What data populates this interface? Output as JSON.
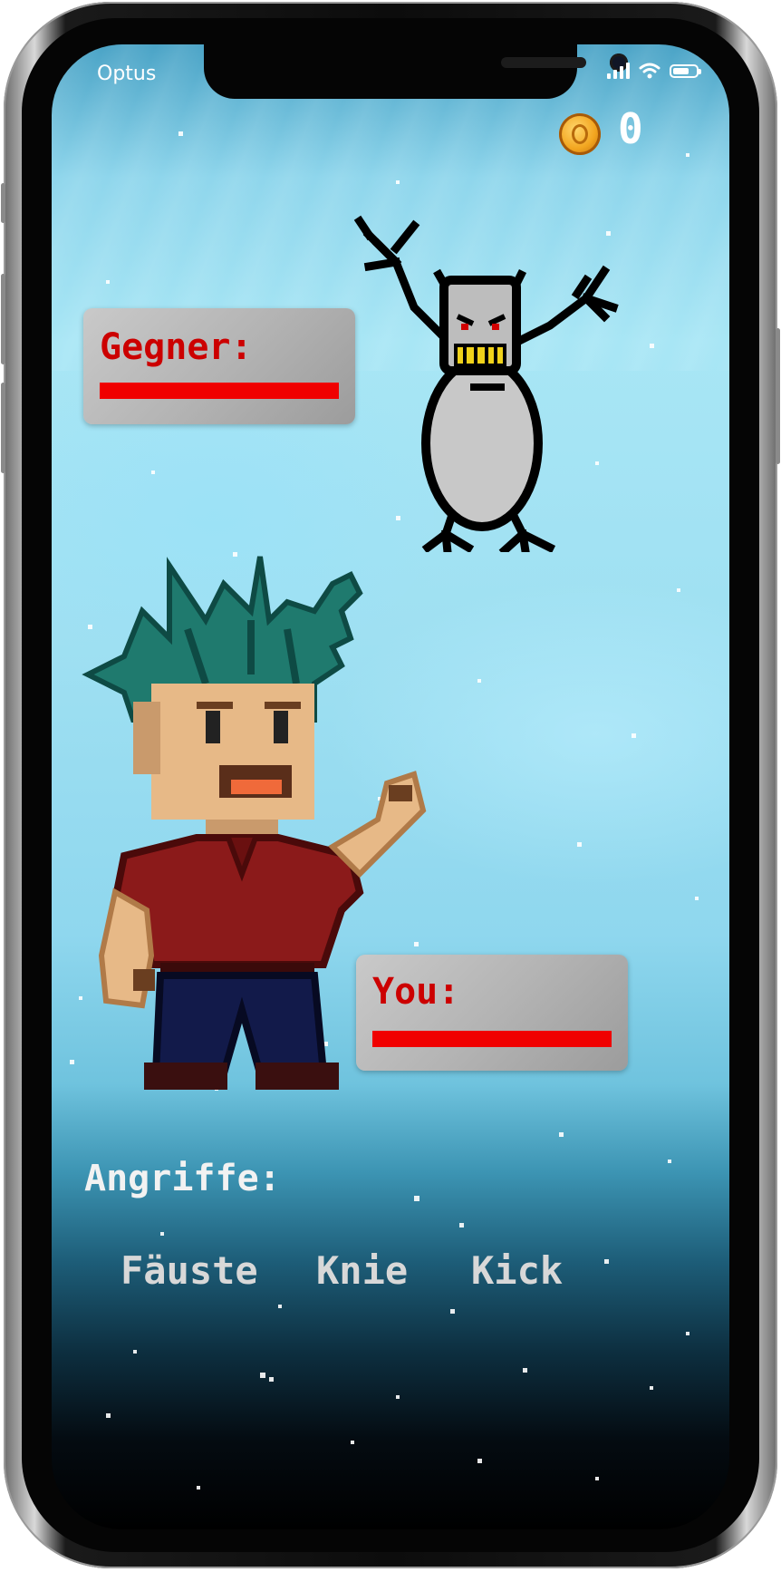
{
  "status_bar": {
    "carrier": "Optus",
    "icons": [
      "signal-icon",
      "wifi-icon",
      "battery-icon"
    ],
    "battery_level": 0.7
  },
  "hud": {
    "coin_icon": "coin-icon",
    "coins": "0"
  },
  "enemy": {
    "label": "Gegner:",
    "health": 1.0,
    "bar_color": "#f00000"
  },
  "player": {
    "label": "You:",
    "health": 1.0,
    "bar_color": "#f00000"
  },
  "attacks": {
    "title": "Angriffe:",
    "options": [
      "Fäuste",
      "Knie",
      "Kick"
    ]
  },
  "colors": {
    "sky": "#a8e6f5",
    "label_red": "#cc0000",
    "hair": "#1f7a6e",
    "shirt": "#8b1a1a",
    "pants": "#121a4a"
  }
}
